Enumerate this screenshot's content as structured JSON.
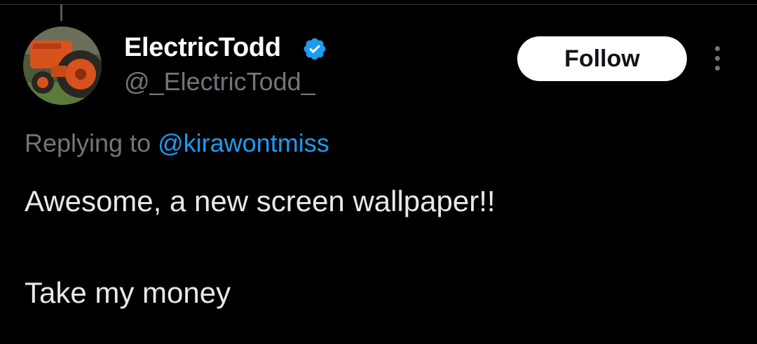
{
  "tweet": {
    "author": {
      "name": "ElectricTodd",
      "handle": "@_ElectricTodd_",
      "verified": true,
      "avatar_icon": "avatar-tractor-image"
    },
    "follow_label": "Follow",
    "more_icon": "more-vertical-icon",
    "reply": {
      "prefix": "Replying to ",
      "mention": "@kirawontmiss"
    },
    "text_lines": [
      "Awesome, a new screen wallpaper!!",
      "Take my money"
    ]
  },
  "colors": {
    "background": "#000000",
    "primary_text": "#e7e9ea",
    "secondary_text": "#71767b",
    "accent": "#1d9bf0",
    "follow_bg": "#ffffff"
  }
}
